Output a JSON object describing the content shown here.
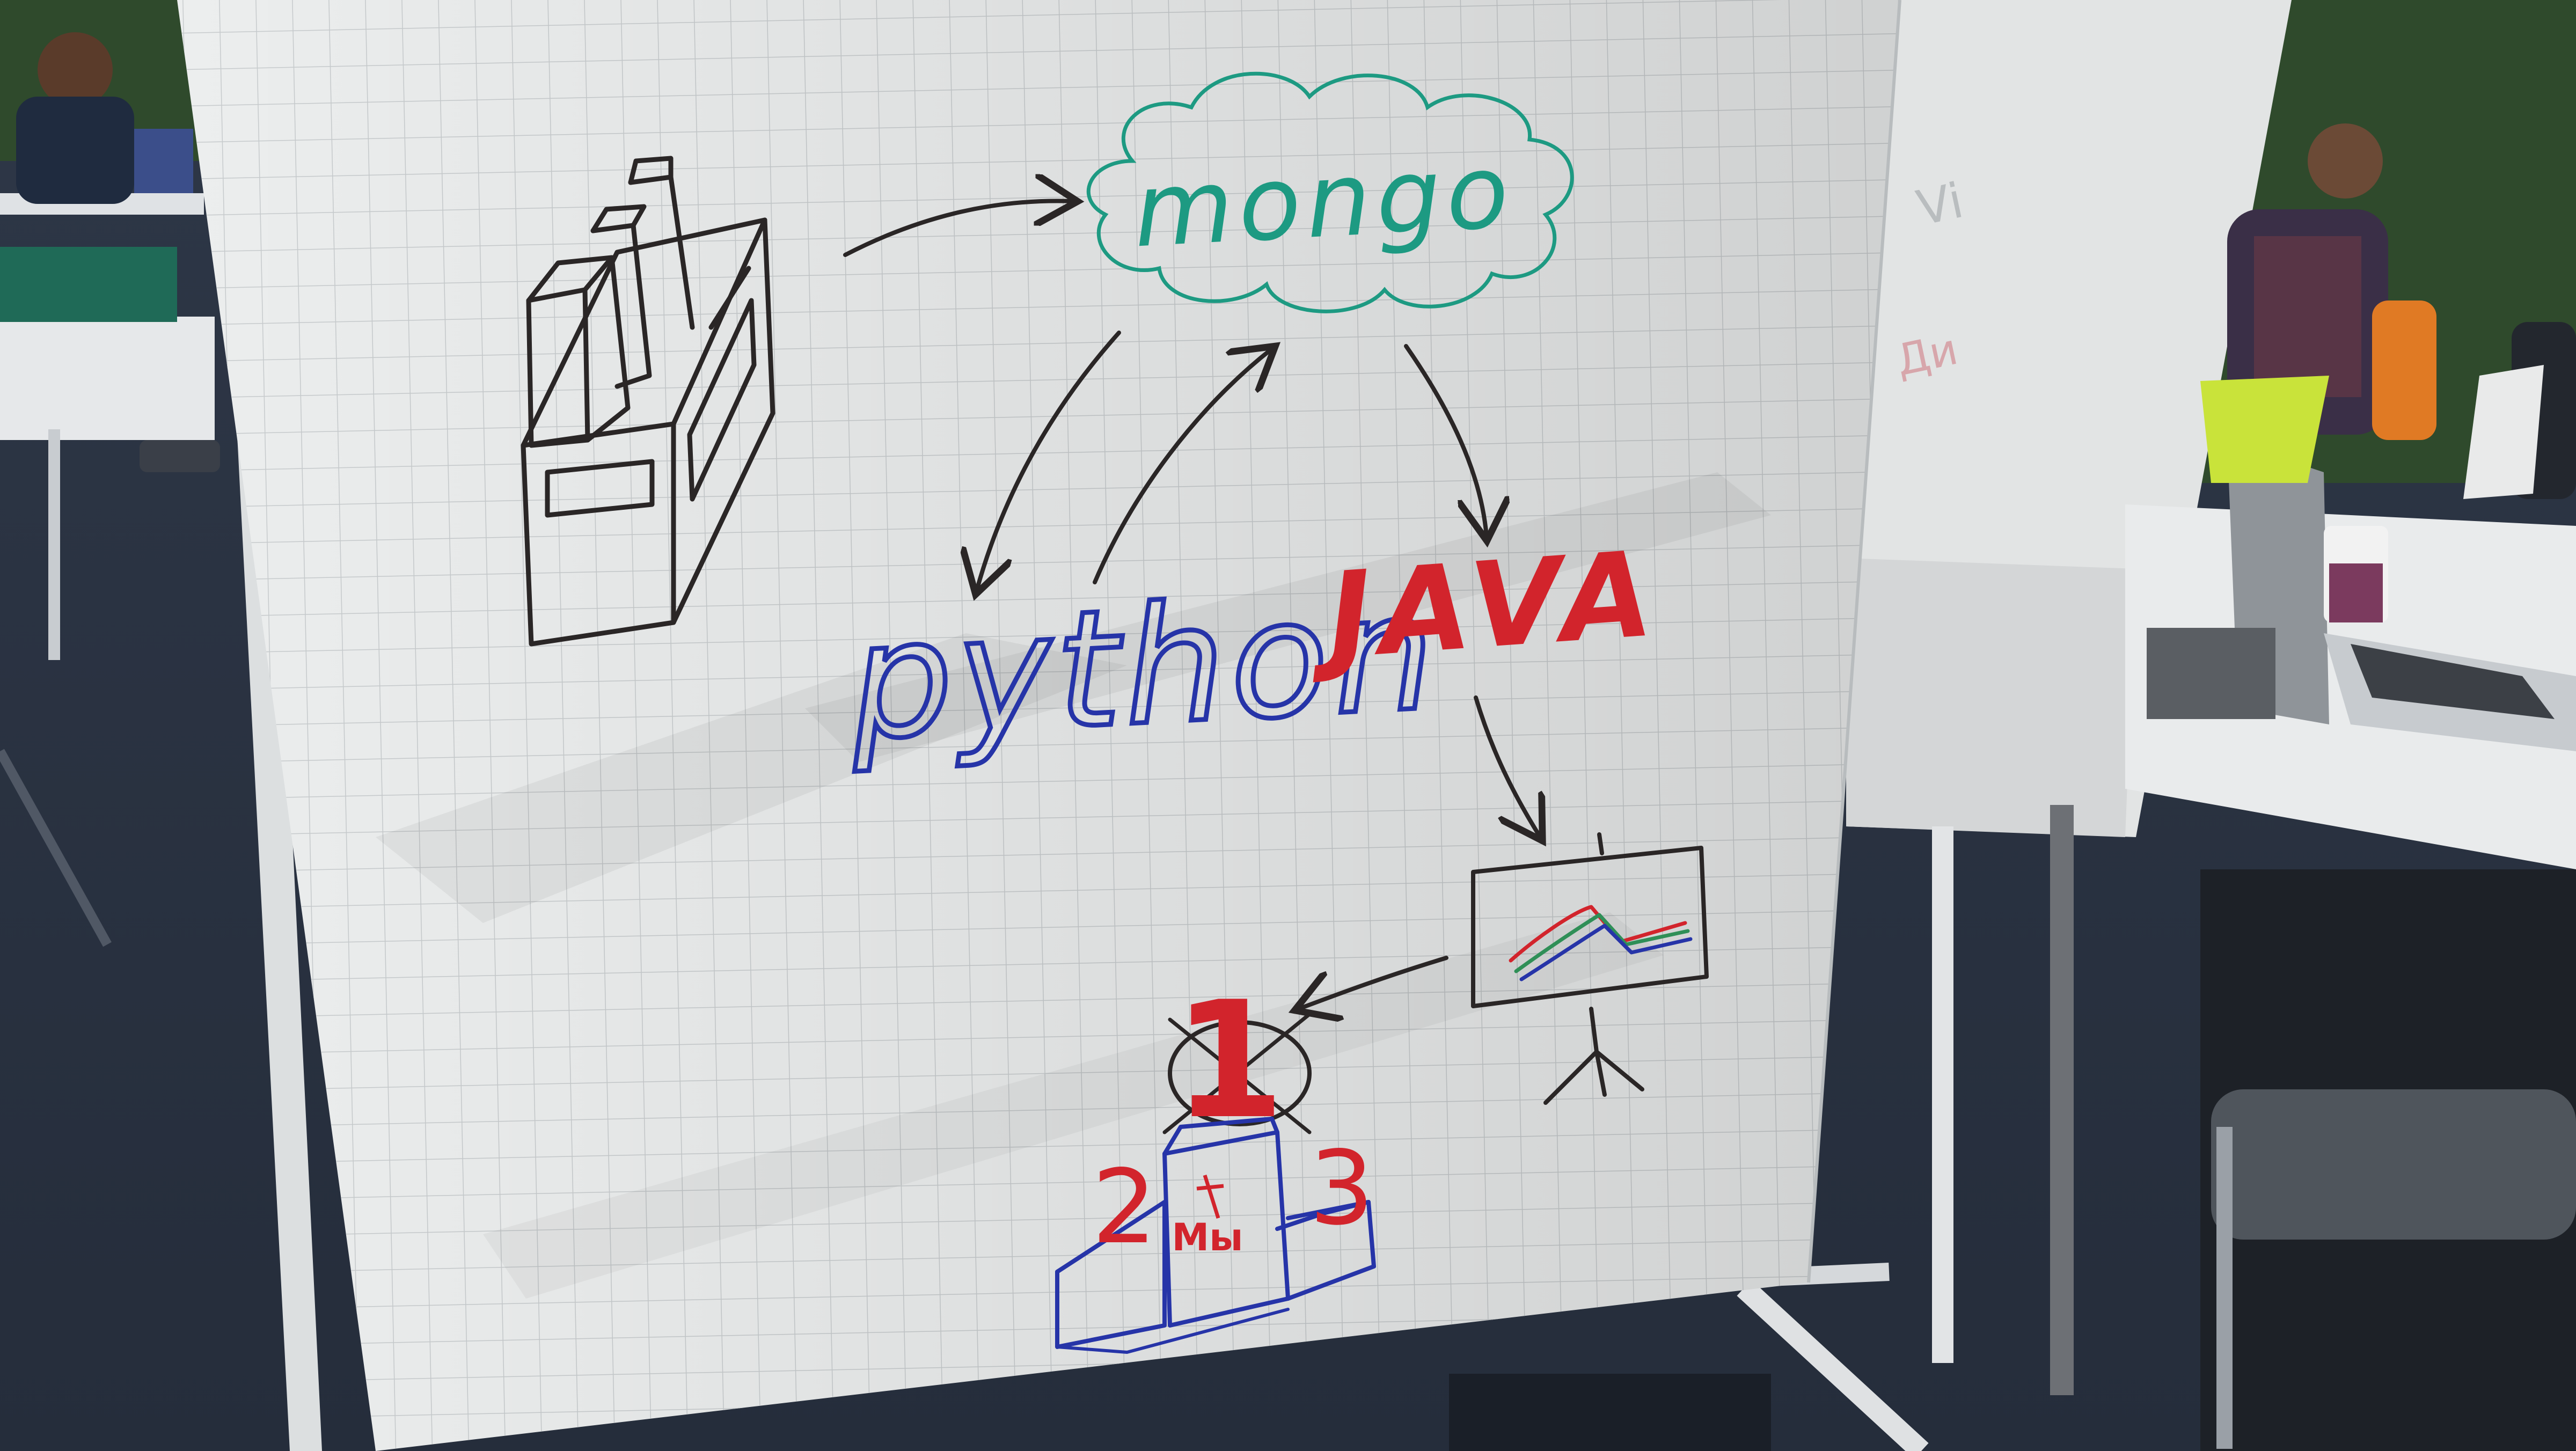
{
  "flipchart": {
    "words": {
      "mongo": "mongo",
      "python": "python",
      "java": "JAVA",
      "rank_first": "1",
      "rank_second": "2",
      "rank_third": "3",
      "podium_label": "Мы"
    }
  },
  "colors": {
    "wall_green": "#2f4a2c",
    "carpet": "#2b3444",
    "paper": "#eceeee",
    "grid": "#c9cdcf",
    "marker_black": "#2a2626",
    "marker_teal": "#1d9a82",
    "marker_blue": "#2634a8",
    "marker_red": "#d2242c",
    "marker_green": "#2f8f57",
    "desk_white": "#e9ebec"
  }
}
